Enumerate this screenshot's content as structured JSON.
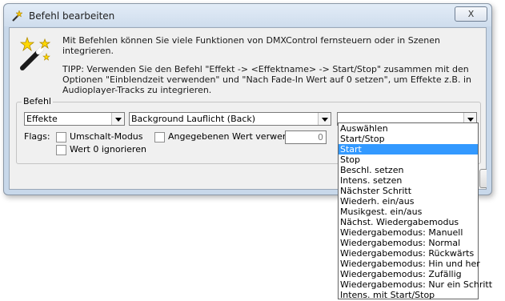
{
  "window": {
    "title": "Befehl bearbeiten",
    "close_label": "X"
  },
  "info": {
    "line1": "Mit Befehlen können Sie viele Funktionen von DMXControl fernsteuern oder in Szenen integrieren.",
    "tip": "TIPP: Verwenden Sie den Befehl \"Effekt -> <Effektname> -> Start/Stop\" zusammen mit den Optionen \"Einblendzeit verwenden\" und \"Nach Fade-In Wert auf 0 setzen\", um Effekte z.B. in Audioplayer-Tracks zu integrieren."
  },
  "group": {
    "label": "Befehl",
    "combo1": "Effekte",
    "combo2": "Background Lauflicht (Back)",
    "combo3": ""
  },
  "flags": {
    "label": "Flags:",
    "umschalt": "Umschalt-Modus",
    "wert_verwenden": "Angegebenen Wert verwenden:",
    "wert_value": "0",
    "wert_null": "Wert 0 ignorieren"
  },
  "dropdown": {
    "items": [
      "Auswählen",
      "Start/Stop",
      "Start",
      "Stop",
      "Beschl. setzen",
      "Intens. setzen",
      "Nächster Schritt",
      "Wiederh. ein/aus",
      "Musikgest. ein/aus",
      "Nächst. Wiedergabemodus",
      "Wiedergabemodus: Manuell",
      "Wiedergabemodus: Normal",
      "Wiedergabemodus: Rückwärts",
      "Wiedergabemodus: Hin und her",
      "Wiedergabemodus: Zufällig",
      "Wiedergabemodus: Nur ein Schritt",
      "Intens. mit Start/Stop"
    ],
    "selected_index": 2
  },
  "colors": {
    "selection": "#3399ff",
    "frame": "#c8d8ea"
  }
}
